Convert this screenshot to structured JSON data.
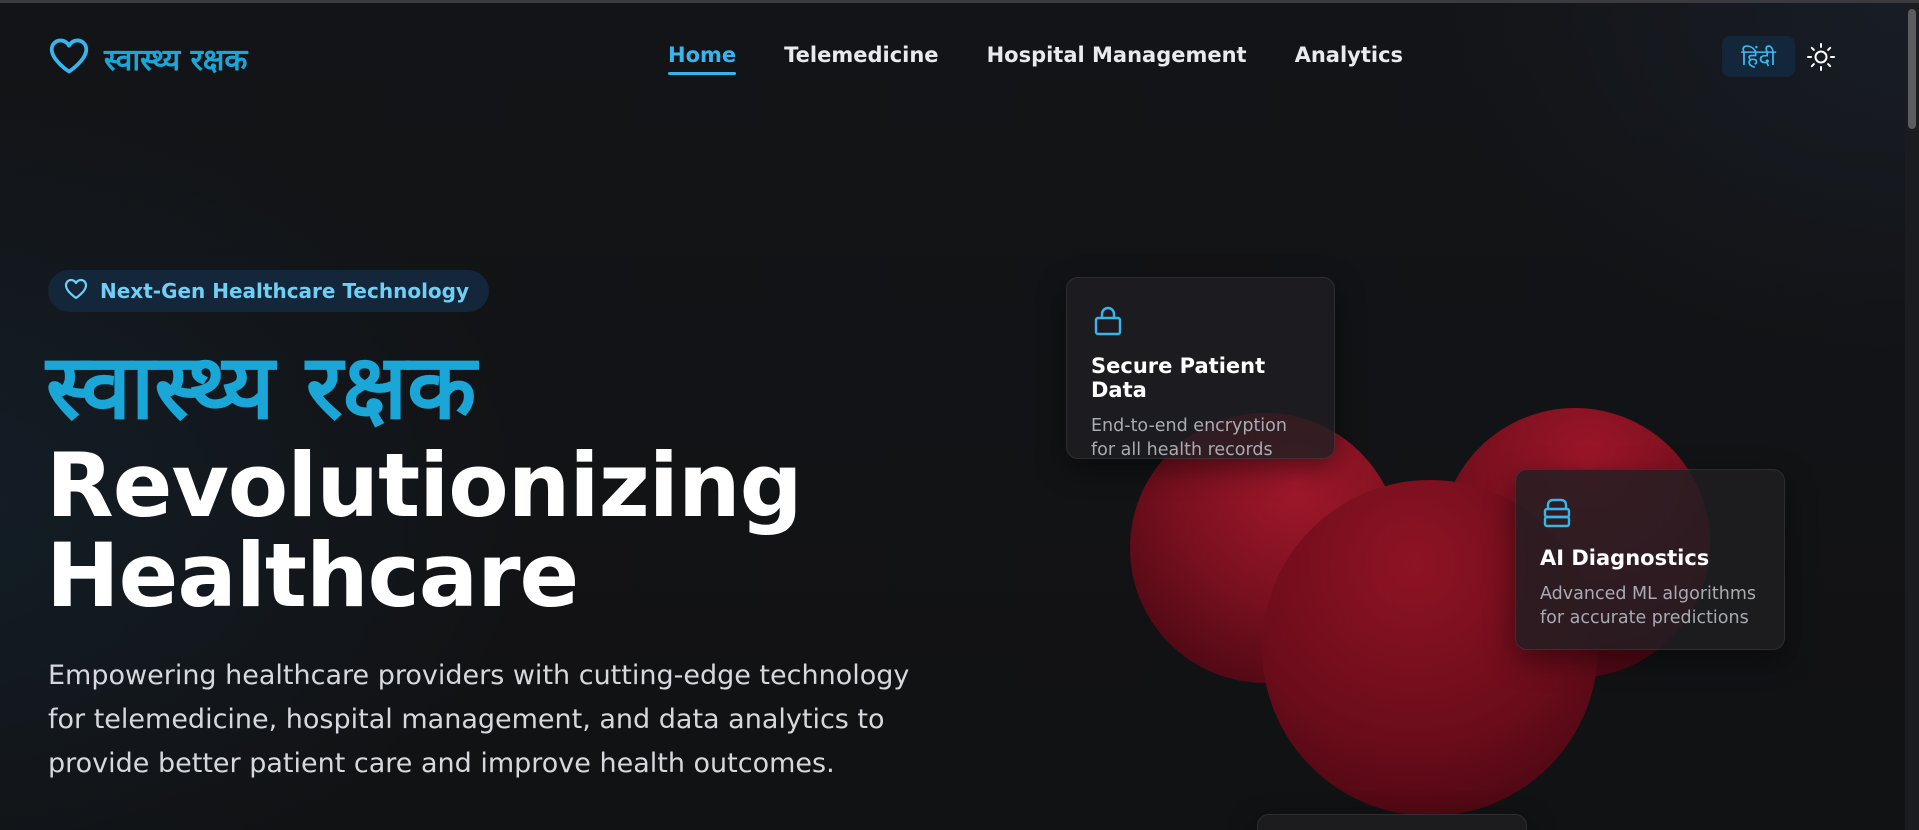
{
  "brand": {
    "name": "स्वास्थ्य रक्षक",
    "icon": "heart-icon",
    "color": "#1aa6d6"
  },
  "nav": {
    "items": [
      {
        "label": "Home",
        "active": true
      },
      {
        "label": "Telemedicine",
        "active": false
      },
      {
        "label": "Hospital Management",
        "active": false
      },
      {
        "label": "Analytics",
        "active": false
      }
    ]
  },
  "header": {
    "language_label": "हिंदी",
    "theme_icon": "sun-icon"
  },
  "hero": {
    "badge": {
      "icon": "heart-icon",
      "label": "Next-Gen Healthcare Technology"
    },
    "hindi_title": "स्वास्थ्य रक्षक",
    "title_line1": "Revolutionizing",
    "title_line2": "Healthcare",
    "description": "Empowering healthcare providers with cutting-edge technology for telemedicine, hospital management, and data analytics to provide better patient care and improve health outcomes."
  },
  "features": [
    {
      "icon": "lock-icon",
      "title": "Secure Patient Data",
      "desc_line1": "End-to-end encryption",
      "desc_line2": "for all health records"
    },
    {
      "icon": "database-icon",
      "title": "AI Diagnostics",
      "desc_line1": "Advanced ML algorithms",
      "desc_line2": "for accurate predictions"
    }
  ],
  "colors": {
    "accent": "#37b6ee",
    "background": "#111214",
    "blob": "#7a0f1e"
  }
}
